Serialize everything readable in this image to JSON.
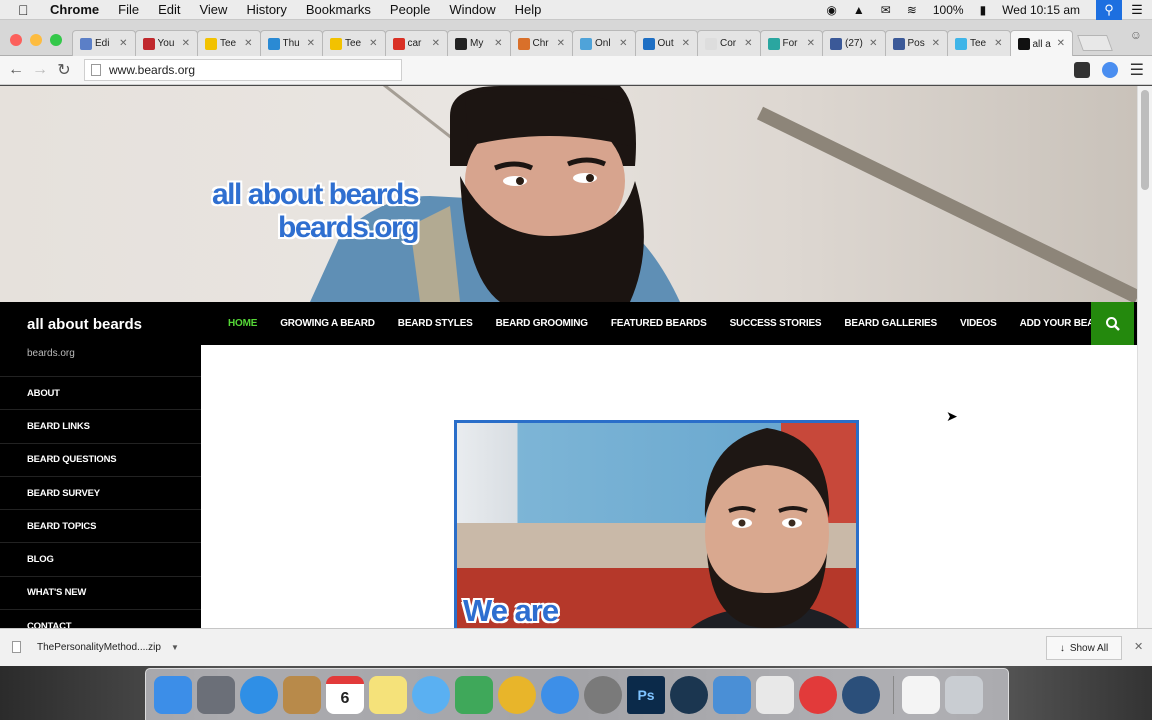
{
  "menubar": {
    "app": "Chrome",
    "items": [
      "File",
      "Edit",
      "View",
      "History",
      "Bookmarks",
      "People",
      "Window",
      "Help"
    ],
    "battery": "100%",
    "clock": "Wed 10:15 am"
  },
  "tabs": [
    {
      "label": "Edi",
      "color": "#5b7fc7"
    },
    {
      "label": "You",
      "color": "#c0282d"
    },
    {
      "label": "Tee",
      "color": "#f2c200"
    },
    {
      "label": "Thu",
      "color": "#2a8ad4"
    },
    {
      "label": "Tee",
      "color": "#f2c200"
    },
    {
      "label": "car",
      "color": "#d93025"
    },
    {
      "label": "My",
      "color": "#222222"
    },
    {
      "label": "Chr",
      "color": "#d9702a"
    },
    {
      "label": "Onl",
      "color": "#4fa3d9"
    },
    {
      "label": "Out",
      "color": "#1e6fc4"
    },
    {
      "label": "Cor",
      "color": "#dddddd"
    },
    {
      "label": "For",
      "color": "#2aa6a0"
    },
    {
      "label": "(27)",
      "color": "#3b5998"
    },
    {
      "label": "Pos",
      "color": "#3b5998"
    },
    {
      "label": "Tee",
      "color": "#3fb5e8"
    },
    {
      "label": "all a",
      "color": "#111111"
    }
  ],
  "toolbar": {
    "url": "www.beards.org"
  },
  "banner": {
    "line1": "all about beards",
    "line2": "beards.org"
  },
  "site": {
    "title": "all about beards",
    "tagline": "beards.org"
  },
  "nav": [
    "HOME",
    "GROWING A BEARD",
    "BEARD STYLES",
    "BEARD GROOMING",
    "FEATURED BEARDS",
    "SUCCESS STORIES",
    "BEARD GALLERIES",
    "VIDEOS",
    "ADD YOUR BEARD"
  ],
  "sidebar": [
    "ABOUT",
    "BEARD LINKS",
    "BEARD QUESTIONS",
    "BEARD SURVEY",
    "BEARD TOPICS",
    "BLOG",
    "WHAT'S NEW",
    "CONTACT"
  ],
  "feature": {
    "text": "We are"
  },
  "download": {
    "file": "ThePersonalityMethod....zip",
    "show_all": "Show All"
  },
  "dock": [
    {
      "name": "finder",
      "color": "#3c8ee8"
    },
    {
      "name": "launchpad",
      "color": "#6b6f78"
    },
    {
      "name": "safari",
      "color": "#2f8fe6"
    },
    {
      "name": "contacts",
      "color": "#b88a4a"
    },
    {
      "name": "calendar",
      "color": "#ffffff"
    },
    {
      "name": "notes",
      "color": "#f5e27a"
    },
    {
      "name": "messages",
      "color": "#5ab0f2"
    },
    {
      "name": "numbers",
      "color": "#3fa85a"
    },
    {
      "name": "chrome",
      "color": "#e8b52a"
    },
    {
      "name": "app-store",
      "color": "#3d8fe8"
    },
    {
      "name": "system-preferences",
      "color": "#7a7a7a"
    },
    {
      "name": "photoshop",
      "color": "#0b2a4a"
    },
    {
      "name": "steam",
      "color": "#1b3650"
    },
    {
      "name": "mail",
      "color": "#4a8fd6"
    },
    {
      "name": "textedit",
      "color": "#e8e8e8"
    },
    {
      "name": "itunes",
      "color": "#e23a3a"
    },
    {
      "name": "quicktime",
      "color": "#2b4f7a"
    },
    {
      "name": "document",
      "color": "#f4f4f4"
    },
    {
      "name": "trash",
      "color": "#c9cdd2"
    }
  ],
  "calendar_day": "6",
  "photoshop_label": "Ps"
}
